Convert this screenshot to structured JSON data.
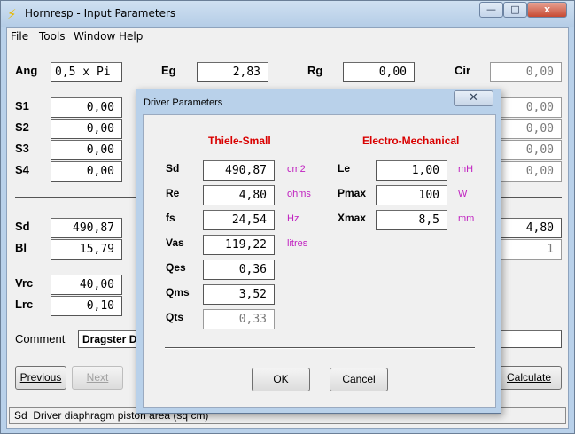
{
  "window": {
    "title": "Hornresp - Input Parameters",
    "menu": [
      "File",
      "Tools",
      "Window",
      "Help"
    ],
    "caption_buttons": {
      "minimize": "—",
      "maximize": "□",
      "close": "x"
    }
  },
  "fields": {
    "ang": {
      "label": "Ang",
      "value": "0,5 x Pi"
    },
    "eg": {
      "label": "Eg",
      "value": "2,83"
    },
    "rg": {
      "label": "Rg",
      "value": "0,00"
    },
    "cir": {
      "label": "Cir",
      "value": "0,00"
    },
    "s1": {
      "label": "S1",
      "value": "0,00"
    },
    "s2": {
      "label": "S2",
      "value": "0,00"
    },
    "s3": {
      "label": "S3",
      "value": "0,00"
    },
    "s4": {
      "label": "S4",
      "value": "0,00"
    },
    "right_s1": "0,00",
    "right_s2": "0,00",
    "right_s3": "0,00",
    "right_s4": "0,00",
    "sd": {
      "label": "Sd",
      "value": "490,87"
    },
    "bl": {
      "label": "Bl",
      "value": "15,79"
    },
    "right_sd_row": "4,80",
    "right_bl_row": "1",
    "vrc": {
      "label": "Vrc",
      "value": "40,00"
    },
    "lrc": {
      "label": "Lrc",
      "value": "0,10"
    },
    "comment": {
      "label": "Comment",
      "value": "Dragster D9"
    }
  },
  "buttons": {
    "previous": "Previous",
    "next": "Next",
    "calculate": "Calculate"
  },
  "status": {
    "field": "Sd",
    "text": "Driver diaphragm piston area (sq cm)"
  },
  "dialog": {
    "title": "Driver Parameters",
    "close": "✕",
    "left_heading": "Thiele-Small",
    "right_heading": "Electro-Mechanical",
    "thiele_small": [
      {
        "label": "Sd",
        "value": "490,87",
        "unit": "cm2"
      },
      {
        "label": "Re",
        "value": "4,80",
        "unit": "ohms"
      },
      {
        "label": "fs",
        "value": "24,54",
        "unit": "Hz"
      },
      {
        "label": "Vas",
        "value": "119,22",
        "unit": "litres"
      },
      {
        "label": "Qes",
        "value": "0,36",
        "unit": ""
      },
      {
        "label": "Qms",
        "value": "3,52",
        "unit": ""
      },
      {
        "label": "Qts",
        "value": "0,33",
        "unit": ""
      }
    ],
    "electro_mechanical": [
      {
        "label": "Le",
        "value": "1,00",
        "unit": "mH"
      },
      {
        "label": "Pmax",
        "value": "100",
        "unit": "W"
      },
      {
        "label": "Xmax",
        "value": "8,5",
        "unit": "mm"
      }
    ],
    "ok": "OK",
    "cancel": "Cancel"
  }
}
